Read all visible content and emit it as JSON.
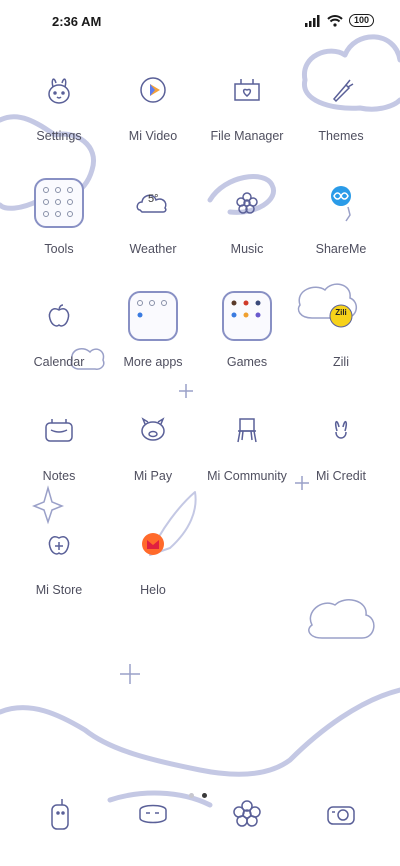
{
  "status_bar": {
    "time": "2:36 AM",
    "battery": "100"
  },
  "apps": [
    {
      "label": "Settings"
    },
    {
      "label": "Mi Video"
    },
    {
      "label": "File Manager"
    },
    {
      "label": "Themes"
    },
    {
      "label": "Tools"
    },
    {
      "label": "Weather",
      "temp": "5°"
    },
    {
      "label": "Music"
    },
    {
      "label": "ShareMe"
    },
    {
      "label": "Calendar"
    },
    {
      "label": "More apps"
    },
    {
      "label": "Games"
    },
    {
      "label": "Zili",
      "badge": "Zili"
    },
    {
      "label": "Notes"
    },
    {
      "label": "Mi Pay"
    },
    {
      "label": "Mi Community"
    },
    {
      "label": "Mi Credit"
    },
    {
      "label": "Mi Store"
    },
    {
      "label": "Helo"
    }
  ],
  "page_indicator": {
    "pages": 2,
    "current": 2
  },
  "colors": {
    "accent": "#8890c4",
    "cloud": "#c4c8e4"
  }
}
